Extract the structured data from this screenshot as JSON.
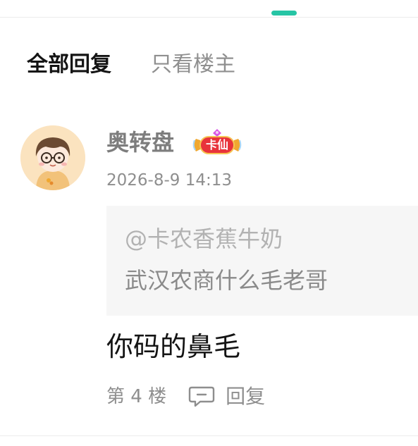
{
  "tabs": {
    "all_replies": "全部回复",
    "op_only": "只看楼主"
  },
  "comment": {
    "username": "奥转盘",
    "badge": "卡仙",
    "timestamp": "2026-8-9 14:13",
    "quote": {
      "mention": "@卡农香蕉牛奶",
      "text": "武汉农商什么毛老哥"
    },
    "reply": "你码的鼻毛",
    "floor": "第 4 楼",
    "reply_label": "回复"
  },
  "colors": {
    "accent": "#26c5a5",
    "badge_red": "#e8333b",
    "badge_gold": "#f0a830",
    "muted_text": "#8e8e8e",
    "quote_bg": "#f6f6f6"
  },
  "icons": {
    "reply": "comment-bubble-icon"
  }
}
